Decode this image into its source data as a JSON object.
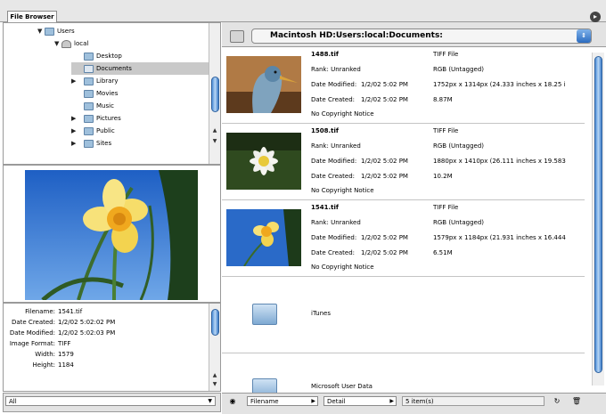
{
  "window": {
    "tab_label": "File Browser"
  },
  "tree": {
    "items": [
      {
        "label": "Users",
        "icon": "folder-icon",
        "expanded": true
      },
      {
        "label": "local",
        "icon": "user-home-icon",
        "expanded": true
      },
      {
        "label": "Desktop",
        "icon": "folder-icon"
      },
      {
        "label": "Documents",
        "icon": "folder-icon",
        "selected": true
      },
      {
        "label": "Library",
        "icon": "folder-icon"
      },
      {
        "label": "Movies",
        "icon": "folder-icon"
      },
      {
        "label": "Music",
        "icon": "folder-icon"
      },
      {
        "label": "Pictures",
        "icon": "folder-icon"
      },
      {
        "label": "Public",
        "icon": "folder-icon"
      },
      {
        "label": "Sites",
        "icon": "folder-icon"
      }
    ]
  },
  "metadata": {
    "rows": [
      {
        "key": "Filename:",
        "value": "1541.tif"
      },
      {
        "key": "Date Created:",
        "value": "1/2/02 5:02:02 PM"
      },
      {
        "key": "Date Modified:",
        "value": "1/2/02 5:02:03 PM"
      },
      {
        "key": "Image Format:",
        "value": "TIFF"
      },
      {
        "key": "Width:",
        "value": "1579"
      },
      {
        "key": "Height:",
        "value": "1184"
      }
    ]
  },
  "left_bottom": {
    "filter_value": "All"
  },
  "toolbar": {
    "path": "Macintosh HD:Users:local:Documents:"
  },
  "files": [
    {
      "name": "1488.tif",
      "type": "TIFF File",
      "rank": "Rank: Unranked",
      "color": "RGB (Untagged)",
      "modified_label": "Date Modified:",
      "modified": "1/2/02   5:02 PM",
      "dims": "1752px x 1314px (24.333 inches x 18.25 i",
      "created_label": "Date Created:",
      "created": "1/2/02   5:02 PM",
      "size": "8.87M",
      "copyright": "No Copyright Notice"
    },
    {
      "name": "1508.tif",
      "type": "TIFF File",
      "rank": "Rank: Unranked",
      "color": "RGB (Untagged)",
      "modified_label": "Date Modified:",
      "modified": "1/2/02   5:02 PM",
      "dims": "1880px x 1410px (26.111 inches x 19.583",
      "created_label": "Date Created:",
      "created": "1/2/02   5:02 PM",
      "size": "10.2M",
      "copyright": "No Copyright Notice"
    },
    {
      "name": "1541.tif",
      "type": "TIFF File",
      "rank": "Rank: Unranked",
      "color": "RGB (Untagged)",
      "modified_label": "Date Modified:",
      "modified": "1/2/02   5:02 PM",
      "dims": "1579px x 1184px (21.931 inches x 16.444",
      "created_label": "Date Created:",
      "created": "1/2/02   5:02 PM",
      "size": "6.51M",
      "copyright": "No Copyright Notice"
    }
  ],
  "folders": [
    {
      "name": "iTunes"
    },
    {
      "name": "Microsoft User Data"
    }
  ],
  "status_bar": {
    "sort_by": "Filename",
    "view_mode": "Detail",
    "item_count": "5 item(s)"
  },
  "colors": {
    "accent": "#3a7bc8",
    "selection": "#c9c9c9",
    "chrome": "#e3e3e3"
  }
}
